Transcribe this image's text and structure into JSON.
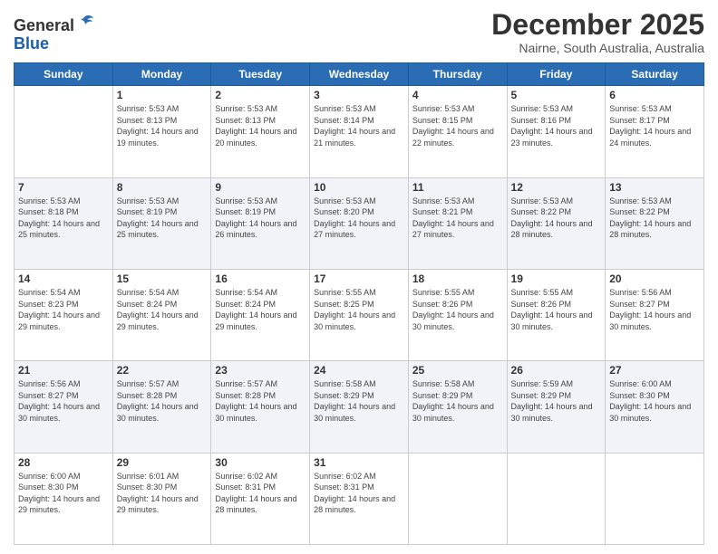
{
  "logo": {
    "general": "General",
    "blue": "Blue"
  },
  "header": {
    "title": "December 2025",
    "subtitle": "Nairne, South Australia, Australia"
  },
  "weekdays": [
    "Sunday",
    "Monday",
    "Tuesday",
    "Wednesday",
    "Thursday",
    "Friday",
    "Saturday"
  ],
  "weeks": [
    [
      {
        "day": "",
        "sunrise": "",
        "sunset": "",
        "daylight": ""
      },
      {
        "day": "1",
        "sunrise": "Sunrise: 5:53 AM",
        "sunset": "Sunset: 8:13 PM",
        "daylight": "Daylight: 14 hours and 19 minutes."
      },
      {
        "day": "2",
        "sunrise": "Sunrise: 5:53 AM",
        "sunset": "Sunset: 8:13 PM",
        "daylight": "Daylight: 14 hours and 20 minutes."
      },
      {
        "day": "3",
        "sunrise": "Sunrise: 5:53 AM",
        "sunset": "Sunset: 8:14 PM",
        "daylight": "Daylight: 14 hours and 21 minutes."
      },
      {
        "day": "4",
        "sunrise": "Sunrise: 5:53 AM",
        "sunset": "Sunset: 8:15 PM",
        "daylight": "Daylight: 14 hours and 22 minutes."
      },
      {
        "day": "5",
        "sunrise": "Sunrise: 5:53 AM",
        "sunset": "Sunset: 8:16 PM",
        "daylight": "Daylight: 14 hours and 23 minutes."
      },
      {
        "day": "6",
        "sunrise": "Sunrise: 5:53 AM",
        "sunset": "Sunset: 8:17 PM",
        "daylight": "Daylight: 14 hours and 24 minutes."
      }
    ],
    [
      {
        "day": "7",
        "sunrise": "Sunrise: 5:53 AM",
        "sunset": "Sunset: 8:18 PM",
        "daylight": "Daylight: 14 hours and 25 minutes."
      },
      {
        "day": "8",
        "sunrise": "Sunrise: 5:53 AM",
        "sunset": "Sunset: 8:19 PM",
        "daylight": "Daylight: 14 hours and 25 minutes."
      },
      {
        "day": "9",
        "sunrise": "Sunrise: 5:53 AM",
        "sunset": "Sunset: 8:19 PM",
        "daylight": "Daylight: 14 hours and 26 minutes."
      },
      {
        "day": "10",
        "sunrise": "Sunrise: 5:53 AM",
        "sunset": "Sunset: 8:20 PM",
        "daylight": "Daylight: 14 hours and 27 minutes."
      },
      {
        "day": "11",
        "sunrise": "Sunrise: 5:53 AM",
        "sunset": "Sunset: 8:21 PM",
        "daylight": "Daylight: 14 hours and 27 minutes."
      },
      {
        "day": "12",
        "sunrise": "Sunrise: 5:53 AM",
        "sunset": "Sunset: 8:22 PM",
        "daylight": "Daylight: 14 hours and 28 minutes."
      },
      {
        "day": "13",
        "sunrise": "Sunrise: 5:53 AM",
        "sunset": "Sunset: 8:22 PM",
        "daylight": "Daylight: 14 hours and 28 minutes."
      }
    ],
    [
      {
        "day": "14",
        "sunrise": "Sunrise: 5:54 AM",
        "sunset": "Sunset: 8:23 PM",
        "daylight": "Daylight: 14 hours and 29 minutes."
      },
      {
        "day": "15",
        "sunrise": "Sunrise: 5:54 AM",
        "sunset": "Sunset: 8:24 PM",
        "daylight": "Daylight: 14 hours and 29 minutes."
      },
      {
        "day": "16",
        "sunrise": "Sunrise: 5:54 AM",
        "sunset": "Sunset: 8:24 PM",
        "daylight": "Daylight: 14 hours and 29 minutes."
      },
      {
        "day": "17",
        "sunrise": "Sunrise: 5:55 AM",
        "sunset": "Sunset: 8:25 PM",
        "daylight": "Daylight: 14 hours and 30 minutes."
      },
      {
        "day": "18",
        "sunrise": "Sunrise: 5:55 AM",
        "sunset": "Sunset: 8:26 PM",
        "daylight": "Daylight: 14 hours and 30 minutes."
      },
      {
        "day": "19",
        "sunrise": "Sunrise: 5:55 AM",
        "sunset": "Sunset: 8:26 PM",
        "daylight": "Daylight: 14 hours and 30 minutes."
      },
      {
        "day": "20",
        "sunrise": "Sunrise: 5:56 AM",
        "sunset": "Sunset: 8:27 PM",
        "daylight": "Daylight: 14 hours and 30 minutes."
      }
    ],
    [
      {
        "day": "21",
        "sunrise": "Sunrise: 5:56 AM",
        "sunset": "Sunset: 8:27 PM",
        "daylight": "Daylight: 14 hours and 30 minutes."
      },
      {
        "day": "22",
        "sunrise": "Sunrise: 5:57 AM",
        "sunset": "Sunset: 8:28 PM",
        "daylight": "Daylight: 14 hours and 30 minutes."
      },
      {
        "day": "23",
        "sunrise": "Sunrise: 5:57 AM",
        "sunset": "Sunset: 8:28 PM",
        "daylight": "Daylight: 14 hours and 30 minutes."
      },
      {
        "day": "24",
        "sunrise": "Sunrise: 5:58 AM",
        "sunset": "Sunset: 8:29 PM",
        "daylight": "Daylight: 14 hours and 30 minutes."
      },
      {
        "day": "25",
        "sunrise": "Sunrise: 5:58 AM",
        "sunset": "Sunset: 8:29 PM",
        "daylight": "Daylight: 14 hours and 30 minutes."
      },
      {
        "day": "26",
        "sunrise": "Sunrise: 5:59 AM",
        "sunset": "Sunset: 8:29 PM",
        "daylight": "Daylight: 14 hours and 30 minutes."
      },
      {
        "day": "27",
        "sunrise": "Sunrise: 6:00 AM",
        "sunset": "Sunset: 8:30 PM",
        "daylight": "Daylight: 14 hours and 30 minutes."
      }
    ],
    [
      {
        "day": "28",
        "sunrise": "Sunrise: 6:00 AM",
        "sunset": "Sunset: 8:30 PM",
        "daylight": "Daylight: 14 hours and 29 minutes."
      },
      {
        "day": "29",
        "sunrise": "Sunrise: 6:01 AM",
        "sunset": "Sunset: 8:30 PM",
        "daylight": "Daylight: 14 hours and 29 minutes."
      },
      {
        "day": "30",
        "sunrise": "Sunrise: 6:02 AM",
        "sunset": "Sunset: 8:31 PM",
        "daylight": "Daylight: 14 hours and 28 minutes."
      },
      {
        "day": "31",
        "sunrise": "Sunrise: 6:02 AM",
        "sunset": "Sunset: 8:31 PM",
        "daylight": "Daylight: 14 hours and 28 minutes."
      },
      {
        "day": "",
        "sunrise": "",
        "sunset": "",
        "daylight": ""
      },
      {
        "day": "",
        "sunrise": "",
        "sunset": "",
        "daylight": ""
      },
      {
        "day": "",
        "sunrise": "",
        "sunset": "",
        "daylight": ""
      }
    ]
  ]
}
